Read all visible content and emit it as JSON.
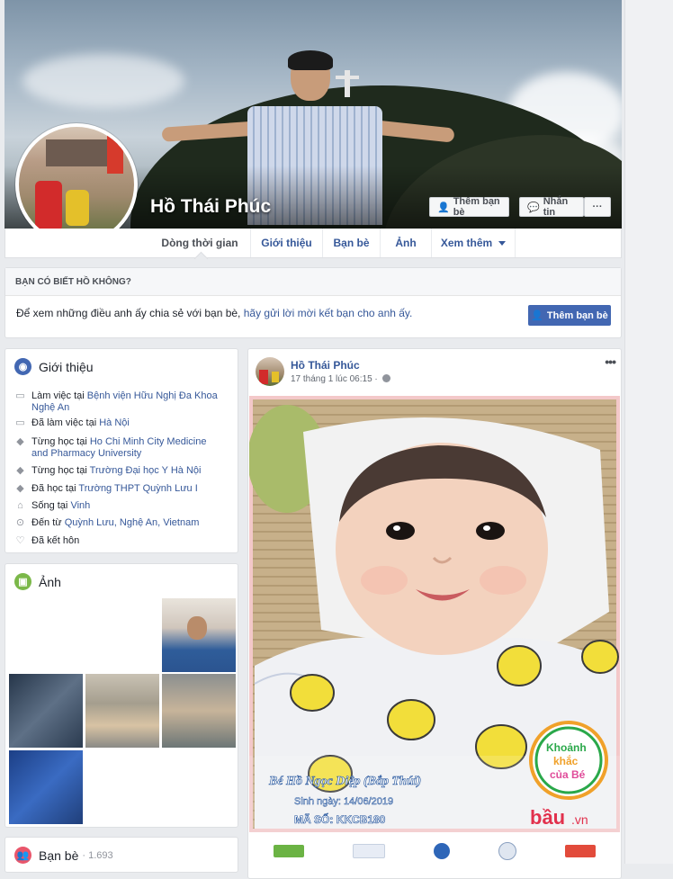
{
  "profile": {
    "name": "Hồ Thái Phúc",
    "add_friend_label": "Thêm bạn bè",
    "message_label": "Nhắn tin",
    "more_label": "···"
  },
  "nav": {
    "tabs": [
      "Dòng thời gian",
      "Giới thiệu",
      "Bạn bè",
      "Ảnh",
      "Xem thêm"
    ]
  },
  "know_card": {
    "heading": "BẠN CÓ BIẾT HỒ KHÔNG?",
    "text": "Để xem những điều anh ấy chia sẻ với bạn bè,",
    "link": "hãy gửi lời mời kết bạn cho anh ấy.",
    "button": "Thêm bạn bè"
  },
  "intro": {
    "title": "Giới thiệu",
    "items": [
      {
        "icon": "briefcase-icon",
        "prefix": "Làm việc tại",
        "link": "Bệnh viện Hữu Nghị Đa Khoa Nghệ An"
      },
      {
        "icon": "briefcase-icon",
        "prefix": "Đã làm việc tại",
        "link": "Hà Nội"
      },
      {
        "icon": "graduation-cap-icon",
        "prefix": "Từng học tại",
        "link": "Ho Chi Minh City Medicine and Pharmacy University"
      },
      {
        "icon": "graduation-cap-icon",
        "prefix": "Từng học tại",
        "link": "Trường Đại học Y Hà Nội"
      },
      {
        "icon": "graduation-cap-icon",
        "prefix": "Đã học tại",
        "link": "Trường THPT Quỳnh Lưu I"
      },
      {
        "icon": "home-icon",
        "prefix": "Sống tại",
        "link": "Vinh"
      },
      {
        "icon": "location-pin-icon",
        "prefix": "Đến từ",
        "link": "Quỳnh Lưu, Nghệ An, Vietnam"
      },
      {
        "icon": "heart-icon",
        "prefix": "Đã kết hôn",
        "link": ""
      }
    ]
  },
  "photos": {
    "title": "Ảnh"
  },
  "friends": {
    "title": "Bạn bè",
    "count": "· 1.693"
  },
  "post": {
    "author": "Hồ Thái Phúc",
    "time": "17 tháng 1 lúc 06:15 ·",
    "caption_name": "Bé Hồ Ngọc Diệp (Bắp Thúi)",
    "caption_dob": "Sinh ngày: 14/06/2019",
    "caption_code": "MÃ SỐ: KKCB180",
    "badge_line1": "Khoảnh",
    "badge_line2": "khắc",
    "badge_line3": "của Bé",
    "brand": "bầu",
    "brand_suffix": ".vn"
  }
}
